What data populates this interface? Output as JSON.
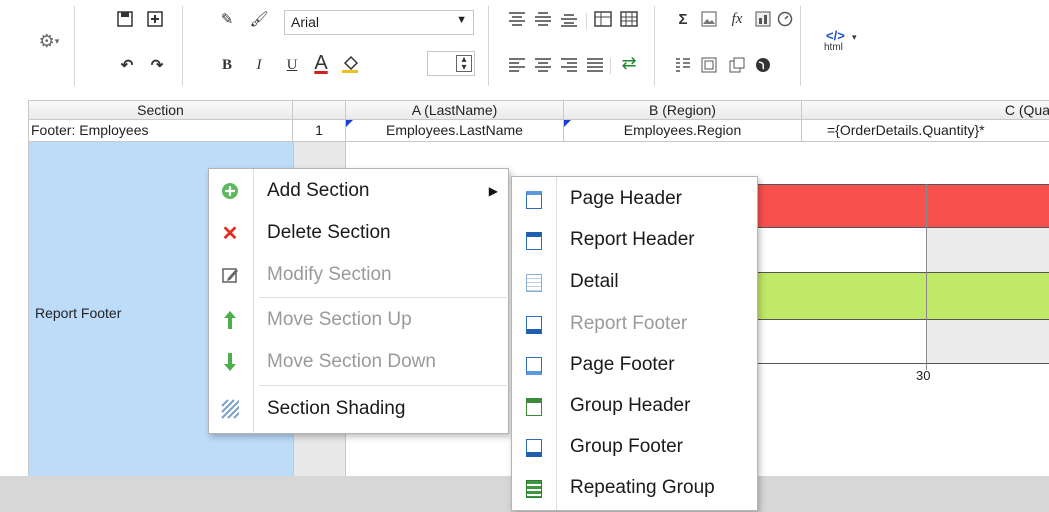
{
  "toolbar": {
    "font_name": "Arial",
    "html_label": "html",
    "icons": [
      "settings-gear-icon",
      "save-icon",
      "add-icon",
      "undo-icon",
      "redo-icon",
      "paint-icon",
      "brush-icon",
      "bold-icon",
      "italic-icon",
      "underline-icon",
      "font-color-icon",
      "fill-color-icon",
      "align-top-icon",
      "align-middle-icon",
      "align-bottom-icon",
      "border-icon",
      "grid-icon",
      "align-left-icon",
      "align-center-icon",
      "align-right-icon",
      "justify-icon",
      "wrap-icon",
      "sum-icon",
      "image-icon",
      "function-icon",
      "chart-icon",
      "gauge-icon",
      "list-icon",
      "table-icon",
      "copy-icon",
      "globe-icon",
      "html-icon"
    ]
  },
  "grid": {
    "headers": {
      "section": "Section",
      "col_a": "A (LastName)",
      "col_b": "B (Region)",
      "col_c": "C (Qua"
    },
    "row1": {
      "section": "Footer: Employees",
      "number": "1",
      "col_a": "Employees.LastName",
      "col_b": "Employees.Region",
      "col_c": "={OrderDetails.Quantity}*"
    },
    "report_footer_label": "Report Footer",
    "axis_tick": "30"
  },
  "context_menu": {
    "items": [
      {
        "label": "Add Section",
        "icon": "add-circle-icon",
        "enabled": true,
        "submenu_arrow": "▶"
      },
      {
        "label": "Delete Section",
        "icon": "delete-x-icon",
        "enabled": true
      },
      {
        "label": "Modify Section",
        "icon": "edit-icon",
        "enabled": false
      },
      {
        "label": "Move Section Up",
        "icon": "arrow-up-icon",
        "enabled": false
      },
      {
        "label": "Move Section Down",
        "icon": "arrow-down-icon",
        "enabled": false
      },
      {
        "label": "Section Shading",
        "icon": "shading-icon",
        "enabled": true
      }
    ]
  },
  "submenu": {
    "items": [
      {
        "label": "Page Header",
        "enabled": true
      },
      {
        "label": "Report Header",
        "enabled": true
      },
      {
        "label": "Detail",
        "enabled": true
      },
      {
        "label": "Report Footer",
        "enabled": false
      },
      {
        "label": "Page Footer",
        "enabled": true
      },
      {
        "label": "Group Header",
        "enabled": true
      },
      {
        "label": "Group Footer",
        "enabled": true
      },
      {
        "label": "Repeating Group",
        "enabled": true
      }
    ]
  },
  "colors": {
    "red_bar": "#f8504e",
    "green_bar": "#c2e86a",
    "section_blue": "#bcdcfa",
    "accent_blue": "#2e6fb5"
  }
}
